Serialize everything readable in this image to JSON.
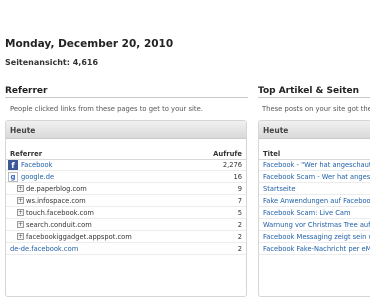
{
  "header": {
    "date": "Monday, December 20, 2010",
    "page_views": "Seitenansicht: 4,616"
  },
  "referrer": {
    "title": "Referrer",
    "description": "People clicked links from these pages to get to your site.",
    "panel_title": "Heute",
    "col_referrer": "Referrer",
    "col_count": "Aufrufe",
    "rows": [
      {
        "label": "Facebook",
        "count": "2,276",
        "icon": "facebook-icon"
      },
      {
        "label": "google.de",
        "count": "16",
        "icon": "google-icon"
      },
      {
        "label": "de.paperblog.com",
        "count": "9",
        "icon": "expand-icon"
      },
      {
        "label": "ws.infospace.com",
        "count": "7",
        "icon": "expand-icon"
      },
      {
        "label": "touch.facebook.com",
        "count": "5",
        "icon": "expand-icon"
      },
      {
        "label": "search.conduit.com",
        "count": "2",
        "icon": "expand-icon"
      },
      {
        "label": "facebookiggadget.appspot.com",
        "count": "2",
        "icon": "expand-icon"
      },
      {
        "label": "de-de.facebook.com",
        "count": "2",
        "icon": "none"
      }
    ]
  },
  "top_articles": {
    "title": "Top Artikel & Seiten",
    "description": "These posts on your site got the m",
    "panel_title": "Heute",
    "col_title": "Titel",
    "rows": [
      {
        "label": "Facebook - \"Wer hat angeschaut\""
      },
      {
        "label": "Facebook Scam - Wer hat angesch"
      },
      {
        "label": "Startseite"
      },
      {
        "label": "Fake Anwendungen auf Facebook"
      },
      {
        "label": "Facebook Scam: Live Cam"
      },
      {
        "label": "Warnung vor Christmas Tree auf F"
      },
      {
        "label": "Facebook Messaging zeigt sein wa"
      },
      {
        "label": "Facebook Fake-Nachricht per eMa"
      }
    ]
  }
}
